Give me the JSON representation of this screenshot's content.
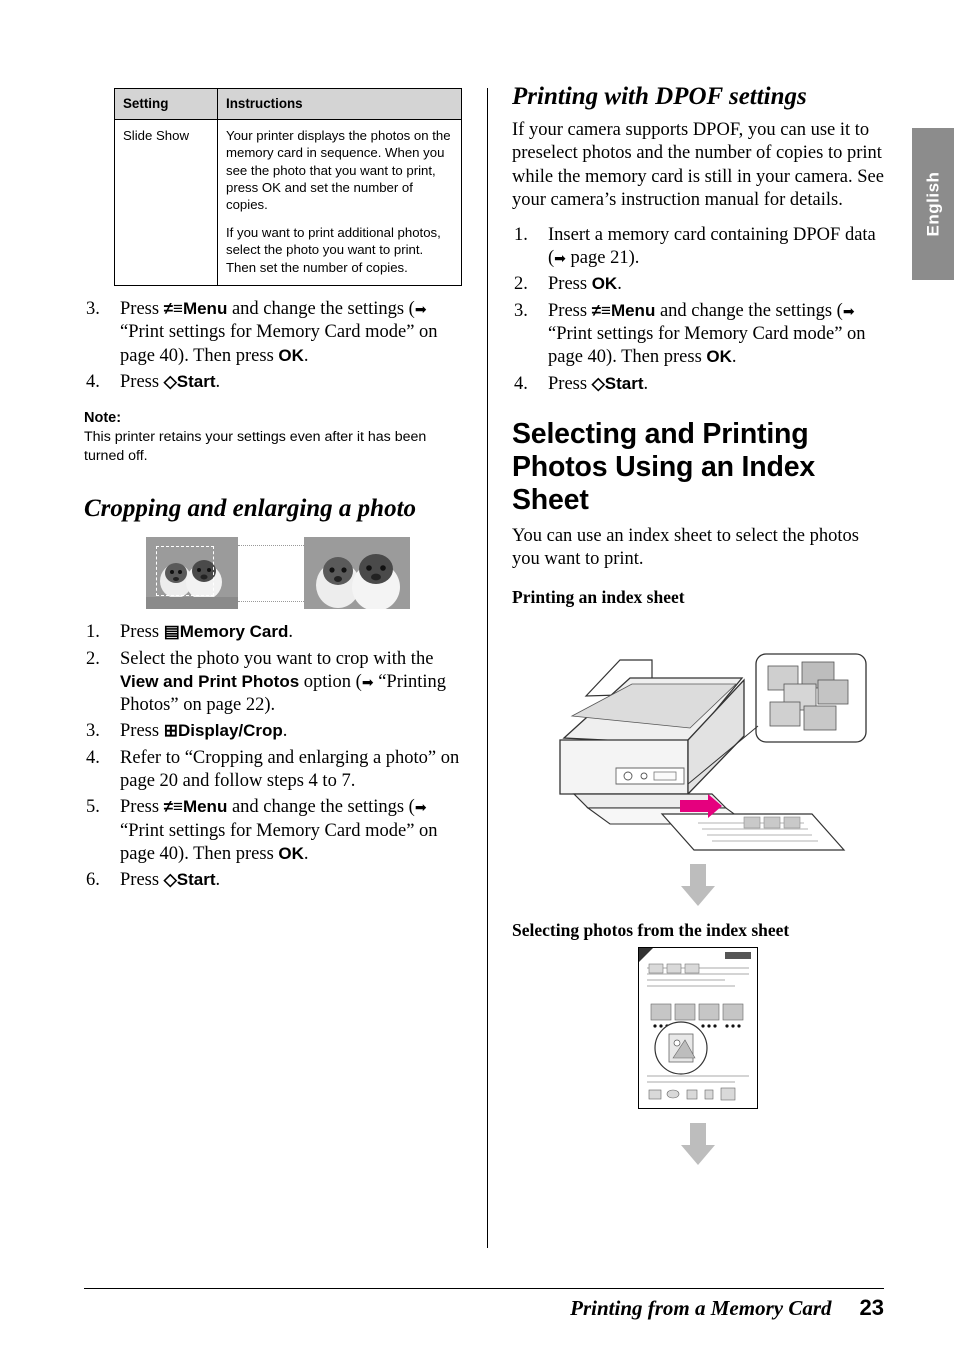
{
  "side_tab": {
    "label": "English"
  },
  "table": {
    "headers": [
      "Setting",
      "Instructions"
    ],
    "rows": [
      {
        "setting": "Slide Show",
        "paragraphs": [
          "Your printer displays the photos on the memory card in sequence. When you see the photo that you want to print, press OK and set the number of copies.",
          "If you want to print additional photos, select the photo you want to print. Then set the number of copies."
        ]
      }
    ]
  },
  "left": {
    "steps_top": [
      {
        "num": "3.",
        "text_a": "Press ",
        "icon": "≠≡",
        "bold": "Menu",
        "text_b": " and change the settings (",
        "arrow": "➡",
        "text_c": " “Print settings for Memory Card mode” on page 40). Then press ",
        "bold2": "OK",
        "text_d": "."
      },
      {
        "num": "4.",
        "text_a": "Press ",
        "icon": "◇",
        "bold": "Start",
        "text_b": "."
      }
    ],
    "note": {
      "title": "Note:",
      "body": "This printer retains your settings even after it has been turned off."
    },
    "heading": "Cropping and enlarging a photo",
    "steps_bottom": [
      {
        "num": "1.",
        "text_a": "Press ",
        "icon": "▤",
        "bold": "Memory Card",
        "text_b": "."
      },
      {
        "num": "2.",
        "text_a": "Select the photo you want to crop with the ",
        "bold": "View and Print Photos",
        "text_b": " option (",
        "arrow": "➡",
        "text_c": " “Printing Photos” on page 22)."
      },
      {
        "num": "3.",
        "text_a": "Press ",
        "icon": "⊞",
        "bold": "Display/Crop",
        "text_b": "."
      },
      {
        "num": "4.",
        "text_a": "Refer to “Cropping and enlarging a photo” on page 20 and follow steps 4 to 7."
      },
      {
        "num": "5.",
        "text_a": "Press ",
        "icon": "≠≡",
        "bold": "Menu",
        "text_b": " and change the settings (",
        "arrow": "➡",
        "text_c": " “Print settings for Memory Card mode” on page 40). Then press ",
        "bold2": "OK",
        "text_d": "."
      },
      {
        "num": "6.",
        "text_a": "Press ",
        "icon": "◇",
        "bold": "Start",
        "text_b": "."
      }
    ]
  },
  "right": {
    "heading_dpof": "Printing with DPOF settings",
    "dpof_intro": "If your camera supports DPOF, you can use it to preselect photos and the number of copies to print while the memory card is still in your camera. See your camera’s instruction manual for details.",
    "dpof_steps": [
      {
        "num": "1.",
        "text_a": "Insert a memory card containing DPOF data (",
        "arrow": "➡",
        "text_c": " page 21)."
      },
      {
        "num": "2.",
        "text_a": "Press ",
        "bold": "OK",
        "text_b": "."
      },
      {
        "num": "3.",
        "text_a": "Press ",
        "icon": "≠≡",
        "bold": "Menu",
        "text_b": " and change the settings (",
        "arrow": "➡",
        "text_c": " “Print settings for Memory Card mode” on page 40). Then press ",
        "bold2": "OK",
        "text_d": "."
      },
      {
        "num": "4.",
        "text_a": "Press ",
        "icon": "◇",
        "bold": "Start",
        "text_b": "."
      }
    ],
    "heading_index": "Selecting and Printing Photos Using an Index Sheet",
    "index_intro": "You can use an index sheet to select the photos you want to print.",
    "sub_printing": "Printing an index sheet",
    "sub_selecting": "Selecting photos from the index sheet"
  },
  "footer": {
    "title": "Printing from a Memory Card",
    "page": "23"
  },
  "colors": {
    "tab_bg": "#8c8c8c",
    "table_header_bg": "#d4d4d4",
    "arrow_gray": "#bdbdbd",
    "magenta": "#e5007e"
  }
}
